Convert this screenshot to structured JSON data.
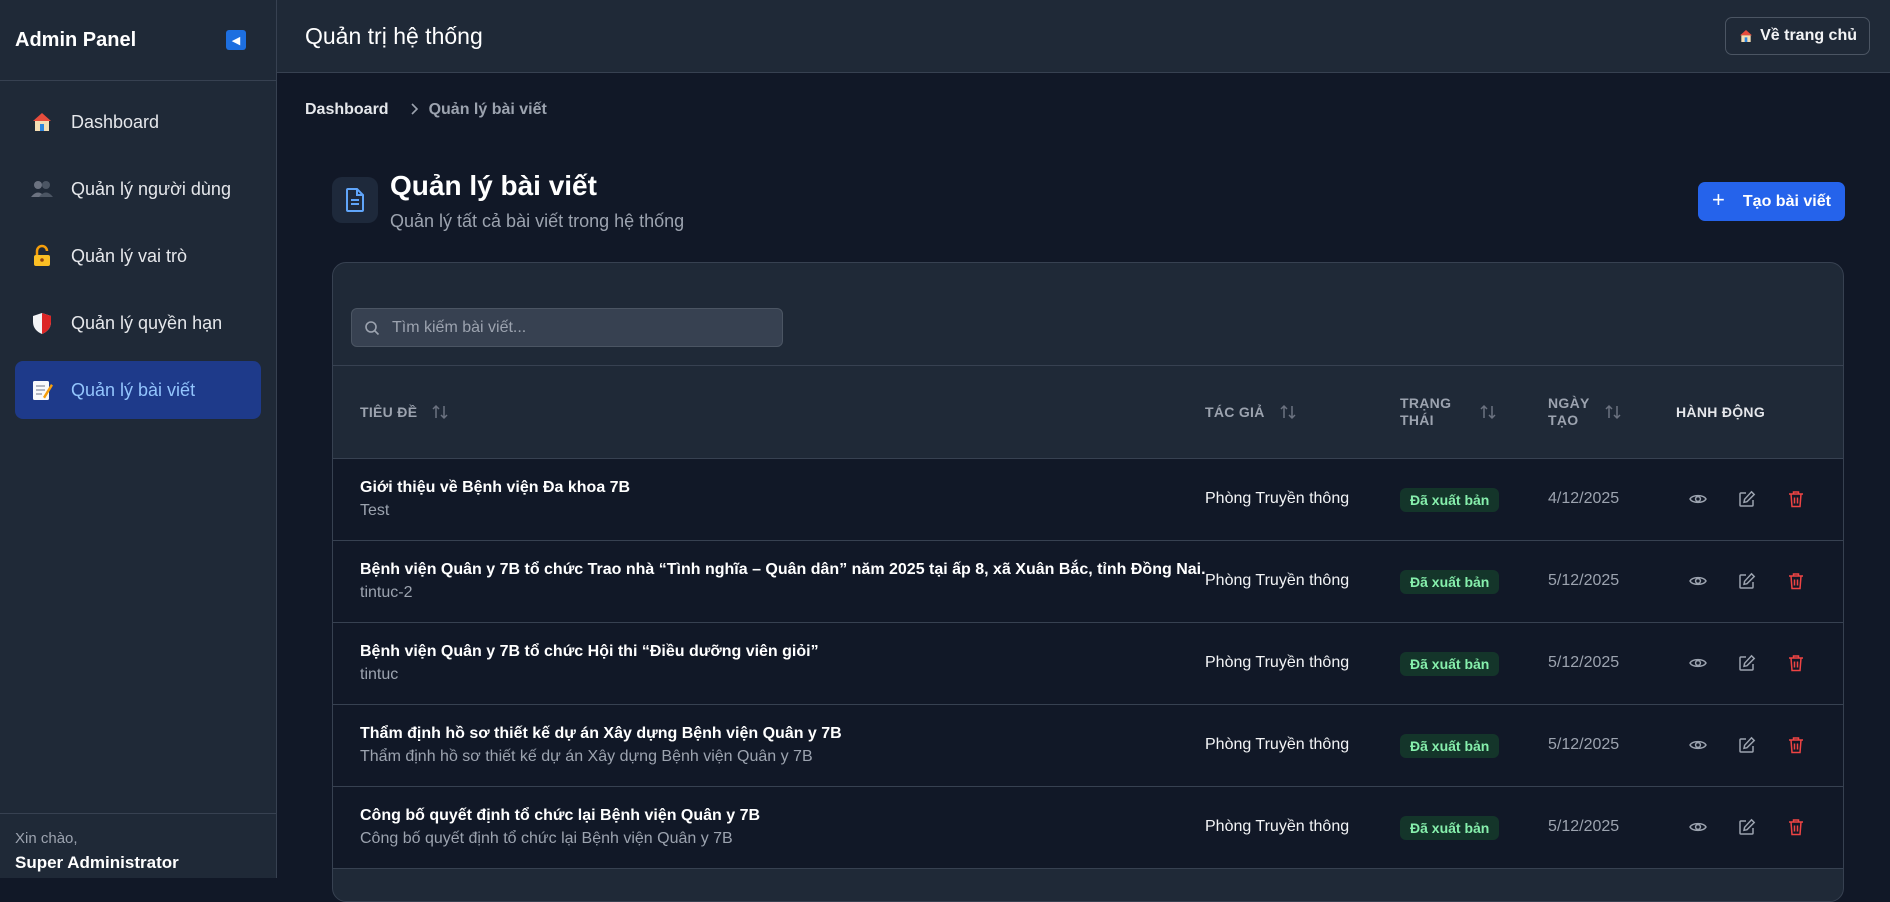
{
  "sidebar": {
    "title": "Admin Panel",
    "items": [
      {
        "label": "Dashboard",
        "icon": "house-icon",
        "active": false
      },
      {
        "label": "Quản lý người dùng",
        "icon": "users-icon",
        "active": false
      },
      {
        "label": "Quản lý vai trò",
        "icon": "lock-key-icon",
        "active": false
      },
      {
        "label": "Quản lý quyền hạn",
        "icon": "shield-icon",
        "active": false
      },
      {
        "label": "Quản lý bài viết",
        "icon": "memo-icon",
        "active": true
      }
    ],
    "greeting": "Xin chào,",
    "user_name": "Super Administrator"
  },
  "topbar": {
    "title": "Quản trị hệ thống",
    "home_button": "Về trang chủ"
  },
  "breadcrumb": {
    "home": "Dashboard",
    "current": "Quản lý bài viết"
  },
  "page": {
    "title": "Quản lý bài viết",
    "subtitle": "Quản lý tất cả bài viết trong hệ thống",
    "create_button": "Tạo bài viết"
  },
  "search": {
    "placeholder": "Tìm kiếm bài viết..."
  },
  "table": {
    "headers": {
      "title": "TIÊU ĐỀ",
      "author": "TÁC GIẢ",
      "status_1": "TRẠNG",
      "status_2": "THÁI",
      "date_1": "NGÀY",
      "date_2": "TẠO",
      "actions": "HÀNH ĐỘNG"
    },
    "rows": [
      {
        "title": "Giới thiệu về Bệnh viện Đa khoa 7B",
        "slug": "Test",
        "author": "Phòng Truyền thông",
        "status": "Đã xuất bản",
        "date": "4/12/2025"
      },
      {
        "title": "Bệnh viện Quân y 7B tổ chức Trao nhà “Tình nghĩa – Quân dân” năm 2025 tại ấp 8, xã Xuân Bắc, tỉnh Đồng Nai.",
        "slug": "tintuc-2",
        "author": "Phòng Truyền thông",
        "status": "Đã xuất bản",
        "date": "5/12/2025"
      },
      {
        "title": "Bệnh viện Quân y 7B tổ chức Hội thi “Điều dưỡng viên giỏi”",
        "slug": "tintuc",
        "author": "Phòng Truyền thông",
        "status": "Đã xuất bản",
        "date": "5/12/2025"
      },
      {
        "title": "Thẩm định hồ sơ thiết kế dự án Xây dựng Bệnh viện Quân y 7B",
        "slug": "Thẩm định hồ sơ thiết kế dự án Xây dựng Bệnh viện Quân y 7B",
        "author": "Phòng Truyền thông",
        "status": "Đã xuất bản",
        "date": "5/12/2025"
      },
      {
        "title": "Công bố quyết định tổ chức lại Bệnh viện Quân y 7B",
        "slug": "Công bố quyết định tổ chức lại Bệnh viện Quân y 7B",
        "author": "Phòng Truyền thông",
        "status": "Đã xuất bản",
        "date": "5/12/2025"
      }
    ]
  },
  "colors": {
    "accent": "#2563eb",
    "badge_bg": "#14352a",
    "badge_text": "#86efac",
    "delete": "#ef4444"
  }
}
